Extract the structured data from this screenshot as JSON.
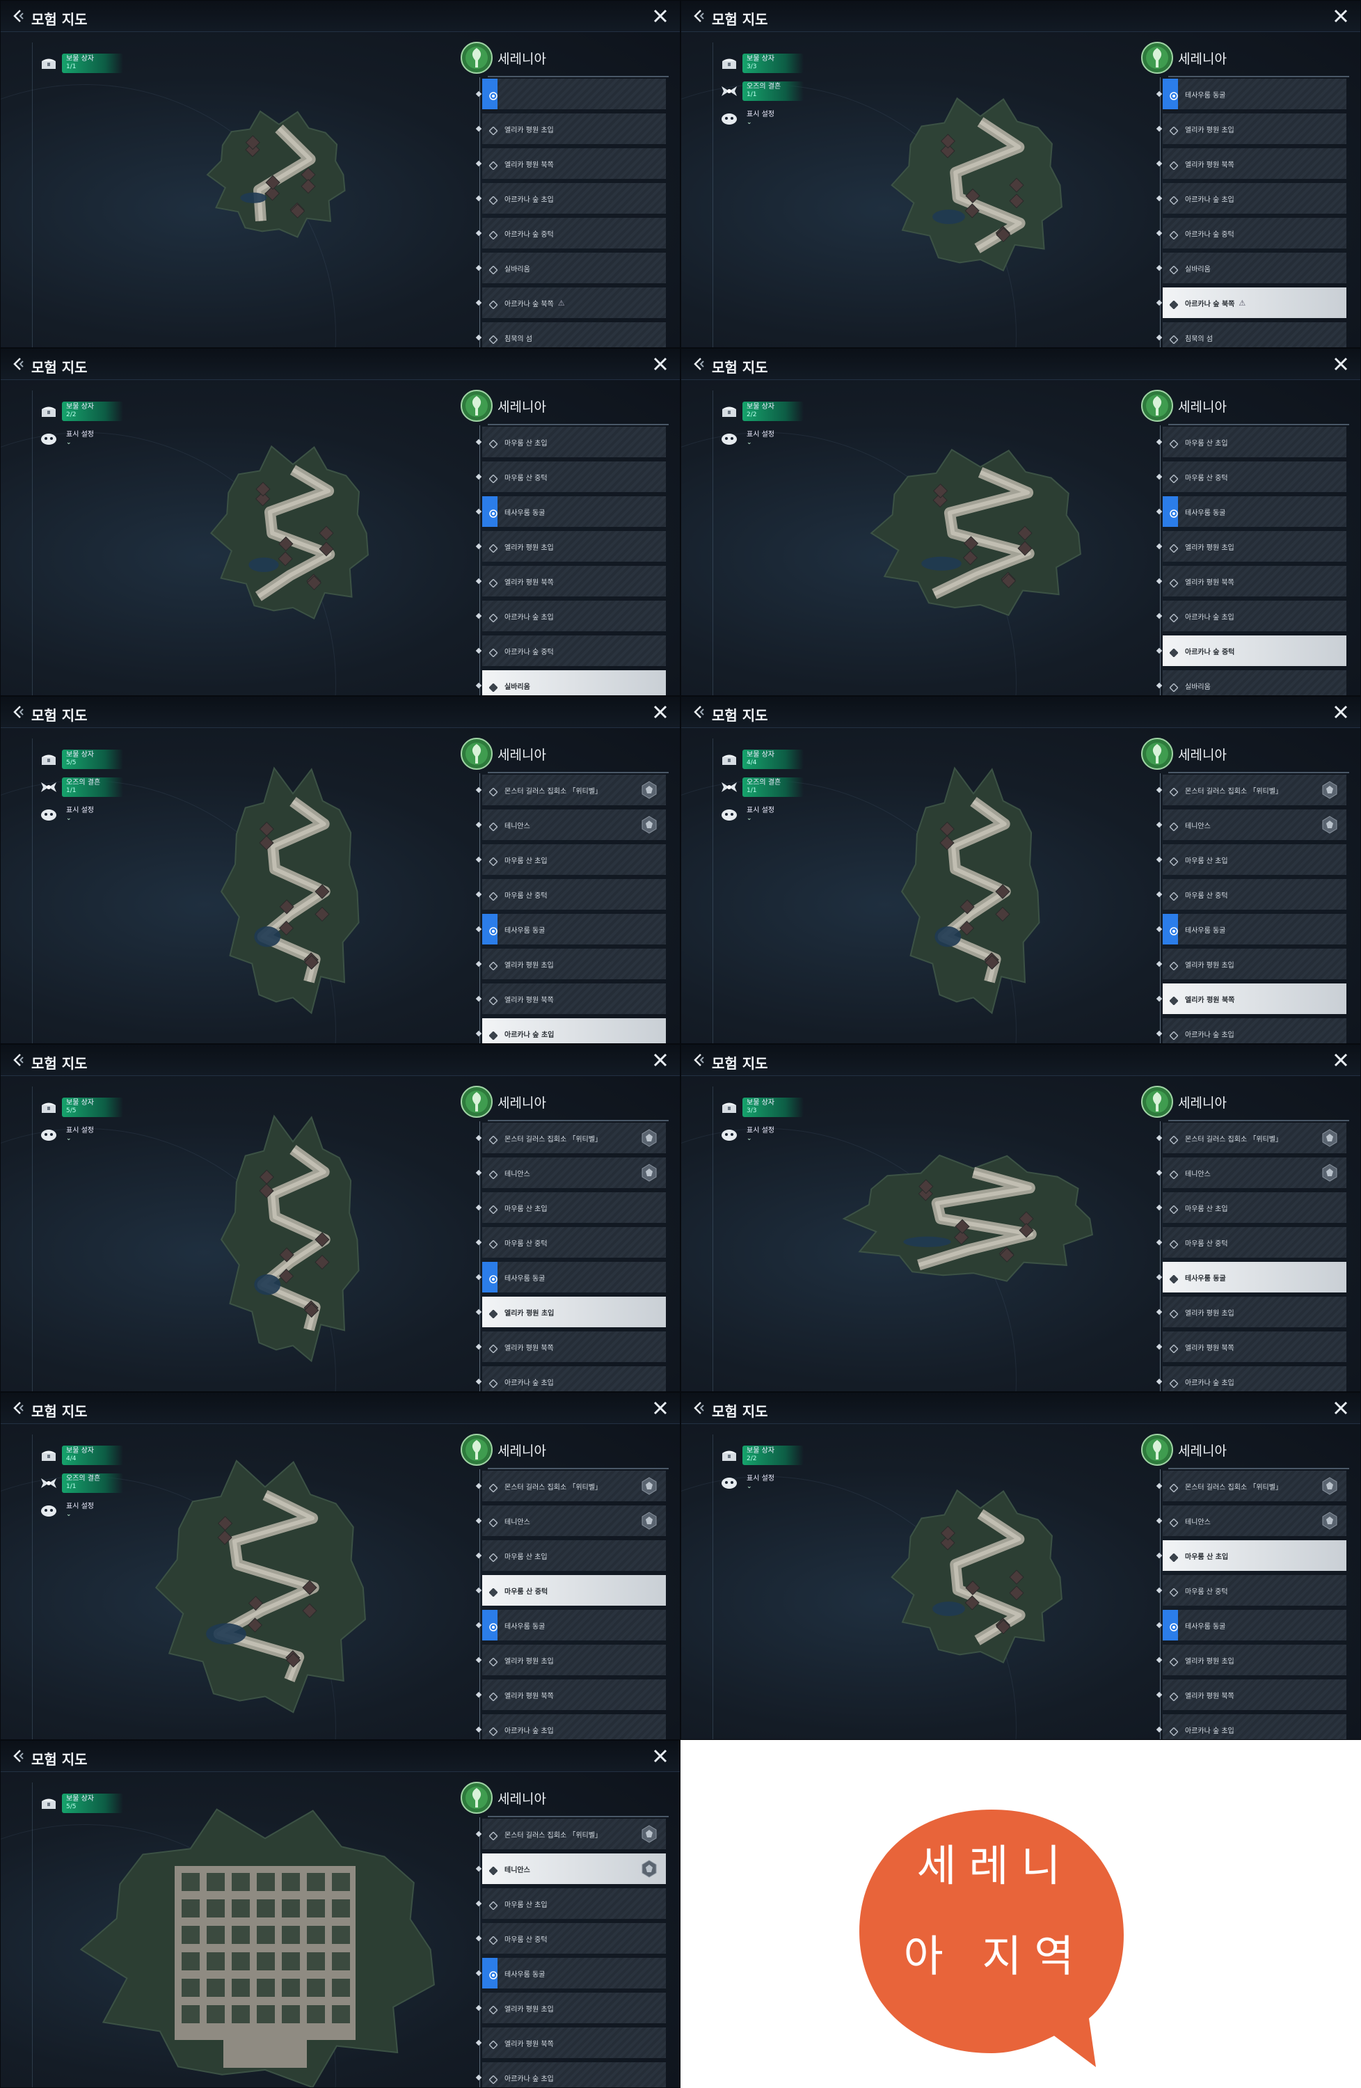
{
  "title": "모험 지도",
  "region": "세레니아",
  "promo": {
    "line1": "세레니",
    "line2": "아 지역",
    "color": "#e8643a"
  },
  "colors": {
    "legend_green": "#16a36c",
    "current_blue": "#2b7de9",
    "selected_bg": "#eef1f4"
  },
  "panels": [
    {
      "legend": [
        {
          "name": "보물 상자",
          "count": "1/1",
          "icon": "chest-icon"
        }
      ],
      "stages": [
        {
          "label": "",
          "state": "current"
        },
        {
          "label": "엘리카 평원 초입"
        },
        {
          "label": "엘리카 평원 북쪽"
        },
        {
          "label": "아르카나 숲 초입"
        },
        {
          "label": "아르카나 숲 중턱"
        },
        {
          "label": "실바리움"
        },
        {
          "label": "아르카나 숲 북쪽",
          "warn": true
        },
        {
          "label": "침묵의 섬"
        },
        {
          "label": "",
          "state": "selected"
        }
      ],
      "map": {
        "shape": "small",
        "fill": "#2c3e33"
      }
    },
    {
      "legend": [
        {
          "name": "보물 상자",
          "count": "3/3",
          "icon": "chest-icon"
        },
        {
          "name": "오즈의 결흔",
          "count": "1/1",
          "icon": "wing-icon"
        },
        {
          "name": "표시 설정",
          "count": "",
          "icon": "eye-icon",
          "plain": true
        }
      ],
      "stages": [
        {
          "label": "테사우룸 동굴",
          "state": "current"
        },
        {
          "label": "엘리카 평원 초입"
        },
        {
          "label": "엘리카 평원 북쪽"
        },
        {
          "label": "아르카나 숲 초입"
        },
        {
          "label": "아르카나 숲 중턱"
        },
        {
          "label": "실바리움"
        },
        {
          "label": "아르카나 숲 북쪽",
          "warn": true,
          "state": "selected"
        },
        {
          "label": "침묵의 섬"
        }
      ],
      "map": {
        "shape": "round",
        "fill": "#2e4236"
      }
    },
    {
      "legend": [
        {
          "name": "보물 상자",
          "count": "2/2",
          "icon": "chest-icon"
        },
        {
          "name": "표시 설정",
          "count": "",
          "icon": "eye-icon",
          "plain": true
        }
      ],
      "stages": [
        {
          "label": "마우룸 산 초입"
        },
        {
          "label": "마우룸 산 중턱"
        },
        {
          "label": "테사우룸 동굴",
          "state": "current"
        },
        {
          "label": "엘리카 평원 초입"
        },
        {
          "label": "엘리카 평원 북쪽"
        },
        {
          "label": "아르카나 숲 초입"
        },
        {
          "label": "아르카나 숲 중턱"
        },
        {
          "label": "실바리움",
          "state": "selected"
        }
      ],
      "map": {
        "shape": "square",
        "fill": "#2c3e33"
      }
    },
    {
      "legend": [
        {
          "name": "보물 상자",
          "count": "2/2",
          "icon": "chest-icon"
        },
        {
          "name": "표시 설정",
          "count": "",
          "icon": "eye-icon",
          "plain": true
        }
      ],
      "stages": [
        {
          "label": "마우룸 산 초입"
        },
        {
          "label": "마우룸 산 중턱"
        },
        {
          "label": "테사우룸 동굴",
          "state": "current"
        },
        {
          "label": "엘리카 평원 초입"
        },
        {
          "label": "엘리카 평원 북쪽"
        },
        {
          "label": "아르카나 숲 초입"
        },
        {
          "label": "아르카나 숲 중턱",
          "state": "selected"
        },
        {
          "label": "실바리움"
        }
      ],
      "map": {
        "shape": "wide",
        "fill": "#2c3e33"
      }
    },
    {
      "legend": [
        {
          "name": "보물 상자",
          "count": "5/5",
          "icon": "chest-icon"
        },
        {
          "name": "오즈의 결흔",
          "count": "1/1",
          "icon": "wing-icon"
        },
        {
          "name": "표시 설정",
          "count": "",
          "icon": "eye-icon",
          "plain": true
        }
      ],
      "stages": [
        {
          "label": "몬스터 길러스 집회소 「위티벨」",
          "badge": true
        },
        {
          "label": "테니안스",
          "badge": true
        },
        {
          "label": "마우룸 산 초입"
        },
        {
          "label": "마우룸 산 중턱"
        },
        {
          "label": "테사우룸 동굴",
          "state": "current"
        },
        {
          "label": "엘리카 평원 초입"
        },
        {
          "label": "엘리카 평원 북쪽"
        },
        {
          "label": "아르카나 숲 초입",
          "state": "selected"
        }
      ],
      "map": {
        "shape": "tall",
        "fill": "#2c3e33"
      }
    },
    {
      "legend": [
        {
          "name": "보물 상자",
          "count": "4/4",
          "icon": "chest-icon"
        },
        {
          "name": "오즈의 결흔",
          "count": "1/1",
          "icon": "wing-icon"
        },
        {
          "name": "표시 설정",
          "count": "",
          "icon": "eye-icon",
          "plain": true
        }
      ],
      "stages": [
        {
          "label": "몬스터 길러스 집회소 「위티벨」",
          "badge": true
        },
        {
          "label": "테니안스",
          "badge": true
        },
        {
          "label": "마우룸 산 초입"
        },
        {
          "label": "마우룸 산 중턱"
        },
        {
          "label": "테사우룸 동굴",
          "state": "current"
        },
        {
          "label": "엘리카 평원 초입"
        },
        {
          "label": "엘리카 평원 북쪽",
          "state": "selected"
        },
        {
          "label": "아르카나 숲 초입"
        }
      ],
      "map": {
        "shape": "tall",
        "fill": "#2c3e33"
      }
    },
    {
      "legend": [
        {
          "name": "보물 상자",
          "count": "5/5",
          "icon": "chest-icon"
        },
        {
          "name": "표시 설정",
          "count": "",
          "icon": "eye-icon",
          "plain": true
        }
      ],
      "stages": [
        {
          "label": "몬스터 길러스 집회소 「위티벨」",
          "badge": true
        },
        {
          "label": "테니안스",
          "badge": true
        },
        {
          "label": "마우룸 산 초입"
        },
        {
          "label": "마우룸 산 중턱"
        },
        {
          "label": "테사우룸 동굴",
          "state": "current"
        },
        {
          "label": "엘리카 평원 초입",
          "state": "selected"
        },
        {
          "label": "엘리카 평원 북쪽"
        },
        {
          "label": "아르카나 숲 초입"
        }
      ],
      "map": {
        "shape": "tall",
        "fill": "#2c3e33"
      }
    },
    {
      "legend": [
        {
          "name": "보물 상자",
          "count": "3/3",
          "icon": "chest-icon"
        },
        {
          "name": "표시 설정",
          "count": "",
          "icon": "eye-icon",
          "plain": true
        }
      ],
      "stages": [
        {
          "label": "몬스터 길러스 집회소 「위티벨」",
          "badge": true
        },
        {
          "label": "테니안스",
          "badge": true
        },
        {
          "label": "마우룸 산 초입"
        },
        {
          "label": "마우룸 산 중턱"
        },
        {
          "label": "테사우룸 동굴",
          "state": "selected"
        },
        {
          "label": "엘리카 평원 초입"
        },
        {
          "label": "엘리카 평원 북쪽"
        },
        {
          "label": "아르카나 숲 초입"
        }
      ],
      "map": {
        "shape": "wideflat",
        "fill": "#2c3e33"
      }
    },
    {
      "legend": [
        {
          "name": "보물 상자",
          "count": "4/4",
          "icon": "chest-icon"
        },
        {
          "name": "오즈의 결흔",
          "count": "1/1",
          "icon": "wing-icon"
        },
        {
          "name": "표시 설정",
          "count": "",
          "icon": "eye-icon",
          "plain": true
        }
      ],
      "stages": [
        {
          "label": "몬스터 길러스 집회소 「위티벨」",
          "badge": true
        },
        {
          "label": "테니안스",
          "badge": true
        },
        {
          "label": "마우룸 산 초입"
        },
        {
          "label": "마우룸 산 중턱",
          "state": "selected"
        },
        {
          "label": "테사우룸 동굴",
          "state": "current"
        },
        {
          "label": "엘리카 평원 초입"
        },
        {
          "label": "엘리카 평원 북쪽"
        },
        {
          "label": "아르카나 숲 초입"
        }
      ],
      "map": {
        "shape": "big",
        "fill": "#2c3e33"
      }
    },
    {
      "legend": [
        {
          "name": "보물 상자",
          "count": "2/2",
          "icon": "chest-icon"
        },
        {
          "name": "표시 설정",
          "count": "",
          "icon": "eye-icon",
          "plain": true
        }
      ],
      "stages": [
        {
          "label": "몬스터 길러스 집회소 「위티벨」",
          "badge": true
        },
        {
          "label": "테니안스",
          "badge": true
        },
        {
          "label": "마우룸 산 초입",
          "state": "selected"
        },
        {
          "label": "마우룸 산 중턱"
        },
        {
          "label": "테사우룸 동굴",
          "state": "current"
        },
        {
          "label": "엘리카 평원 초입"
        },
        {
          "label": "엘리카 평원 북쪽"
        },
        {
          "label": "아르카나 숲 초입"
        }
      ],
      "map": {
        "shape": "round",
        "fill": "#2c3e33"
      }
    },
    {
      "legend": [
        {
          "name": "보물 상자",
          "count": "5/5",
          "icon": "chest-icon"
        }
      ],
      "stages": [
        {
          "label": "몬스터 길러스 집회소 「위티벨」",
          "badge": true
        },
        {
          "label": "테니안스",
          "badge": true,
          "state": "selected"
        },
        {
          "label": "마우룸 산 초입"
        },
        {
          "label": "마우룸 산 중턱"
        },
        {
          "label": "테사우룸 동굴",
          "state": "current"
        },
        {
          "label": "엘리카 평원 초입"
        },
        {
          "label": "엘리카 평원 북쪽"
        },
        {
          "label": "아르카나 숲 초입"
        }
      ],
      "map": {
        "shape": "town",
        "fill": "#2c3e33"
      }
    }
  ]
}
